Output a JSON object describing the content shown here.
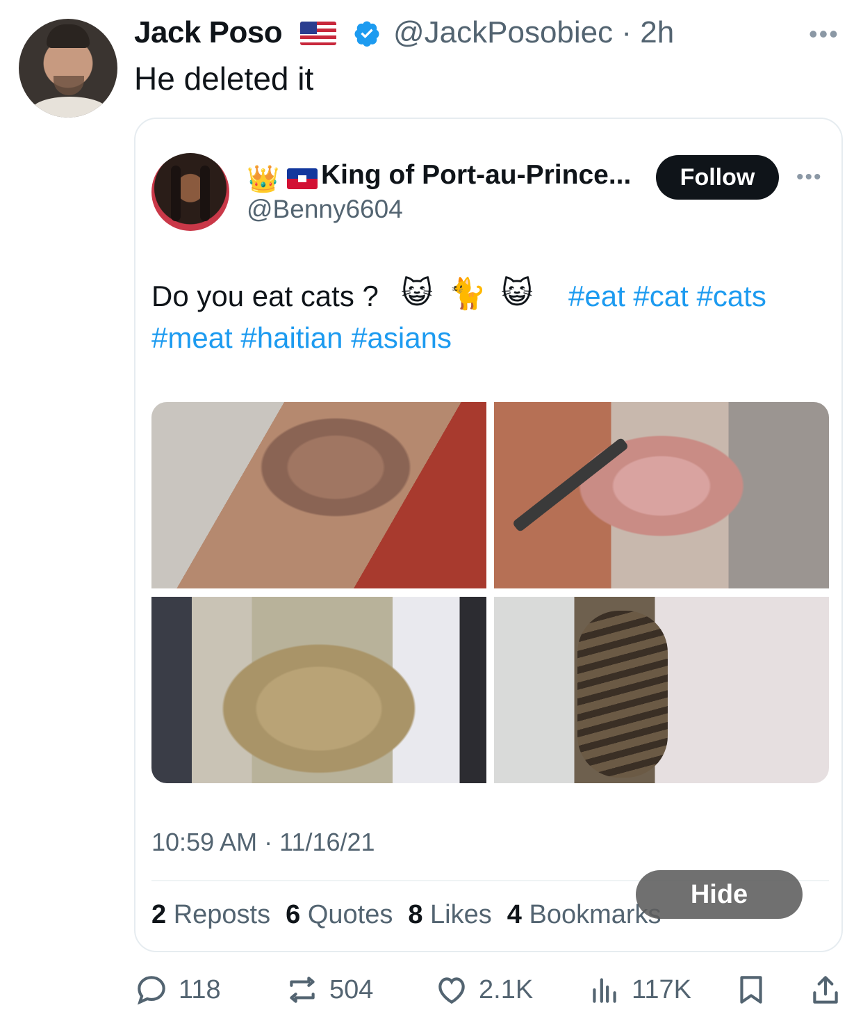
{
  "author": {
    "name": "Jack Poso",
    "flag": "🇺🇸",
    "handle": "@JackPosobiec",
    "separator": "·",
    "time": "2h",
    "verified": true,
    "more_icon": "more-horizontal-icon"
  },
  "tweet": {
    "text": "He deleted it"
  },
  "quoted": {
    "display_name": "King of Port-au-Prince...",
    "handle": "@Benny6604",
    "follow_label": "Follow",
    "text_line1": "Do you eat cats ?",
    "emojis": [
      "😺",
      "🐈",
      "😺"
    ],
    "hashtags_line1": "#eat #cat #cats",
    "hashtags_line2": "#meat #haitian #asians",
    "timestamp": "10:59 AM · 11/16/21",
    "stats": [
      {
        "count": "2",
        "label": "Reposts"
      },
      {
        "count": "6",
        "label": "Quotes"
      },
      {
        "count": "8",
        "label": "Likes"
      },
      {
        "count": "4",
        "label": "Bookmarks"
      }
    ],
    "hide_label": "Hide",
    "media_count": 4
  },
  "actions": {
    "replies": "118",
    "reposts": "504",
    "likes": "2.1K",
    "views": "117K"
  },
  "colors": {
    "link": "#1d9bf0",
    "secondary_text": "#536471",
    "verified_badge": "#1d9bf0"
  }
}
